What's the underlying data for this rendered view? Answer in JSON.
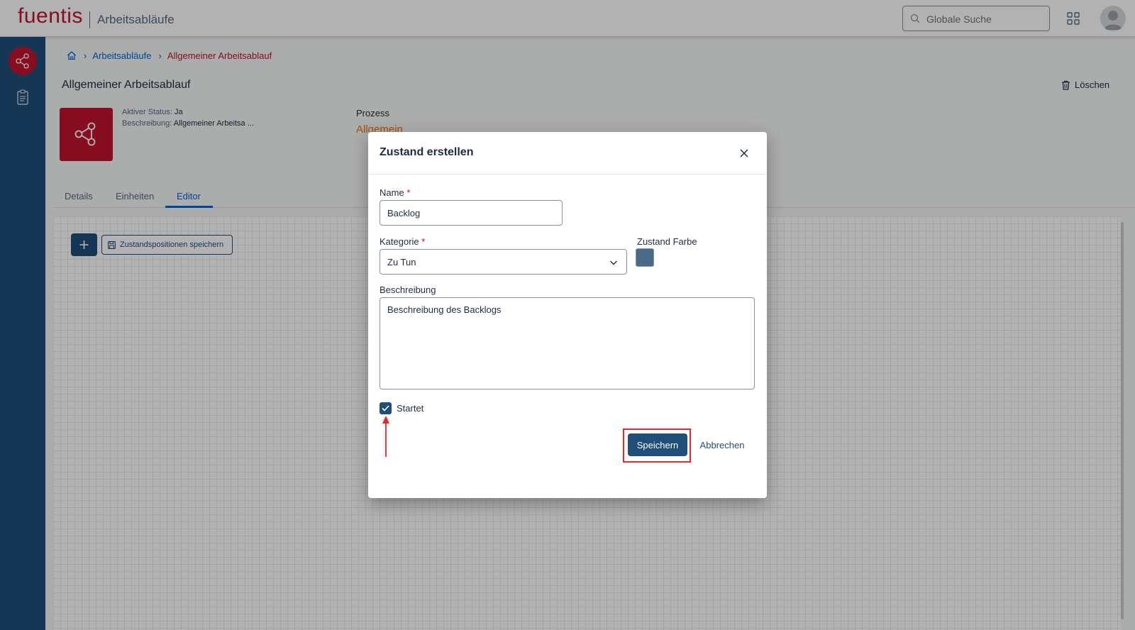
{
  "header": {
    "logo": "fuentis",
    "app_title": "Arbeitsabläufe",
    "search_placeholder": "Globale Suche"
  },
  "breadcrumb": {
    "items": [
      "Arbeitsabläufe",
      "Allgemeiner Arbeitsablauf"
    ]
  },
  "page": {
    "title": "Allgemeiner Arbeitsablauf",
    "delete_label": "Löschen",
    "attributes": {
      "status_key": "Aktiver Status:",
      "status_value": "Ja",
      "desc_key": "Beschreibung:",
      "desc_value": "Allgemeiner Arbeitsa ..."
    },
    "prozess_label": "Prozess",
    "prozess_value": "Allgemein"
  },
  "tabs": [
    {
      "label": "Details"
    },
    {
      "label": "Einheiten"
    },
    {
      "label": "Editor"
    }
  ],
  "active_tab": "Editor",
  "toolbar": {
    "save_positions_label": "Zustandspositionen speichern"
  },
  "dialog": {
    "title": "Zustand erstellen",
    "name_label": "Name",
    "name_value": "Backlog",
    "category_label": "Kategorie",
    "category_value": "Zu Tun",
    "color_label": "Zustand Farbe",
    "color_value": "#4a6a8a",
    "description_label": "Beschreibung",
    "description_value": "Beschreibung des Backlogs",
    "checkbox_label": "Startet",
    "checkbox_checked": true,
    "save_label": "Speichern",
    "cancel_label": "Abbrechen",
    "required_marker": "*"
  },
  "colors": {
    "brand_red": "#c0152f",
    "primary_blue": "#1f4e79",
    "link_blue": "#0064d9",
    "accent_orange": "#e9730c",
    "annotation_red": "#e52929"
  }
}
